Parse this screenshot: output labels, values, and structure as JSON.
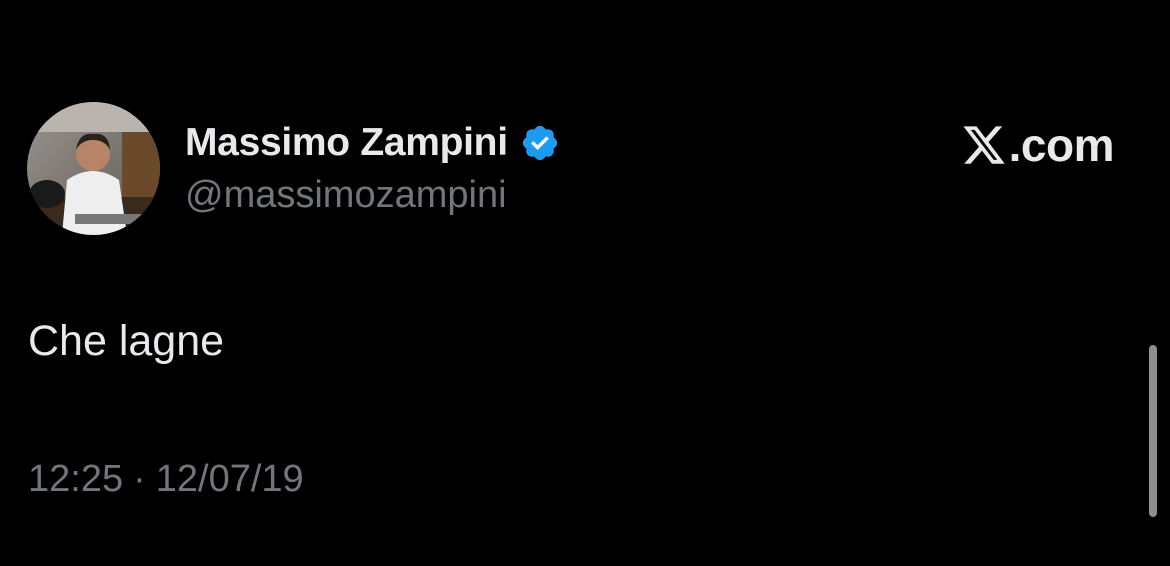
{
  "author": {
    "name": "Massimo Zampini",
    "handle": "@massimozampini",
    "verified": true,
    "verified_icon": "verified-badge-icon",
    "avatar_icon": "profile-photo"
  },
  "brand": {
    "icon": "x-logo-icon",
    "text": ".com"
  },
  "tweet": {
    "text": "Che lagne",
    "time": "12:25",
    "separator": "·",
    "date": "12/07/19"
  },
  "colors": {
    "background": "#000000",
    "primary_text": "#e7e9ea",
    "secondary_text": "#71767b",
    "verified_blue": "#1d9bf0"
  }
}
